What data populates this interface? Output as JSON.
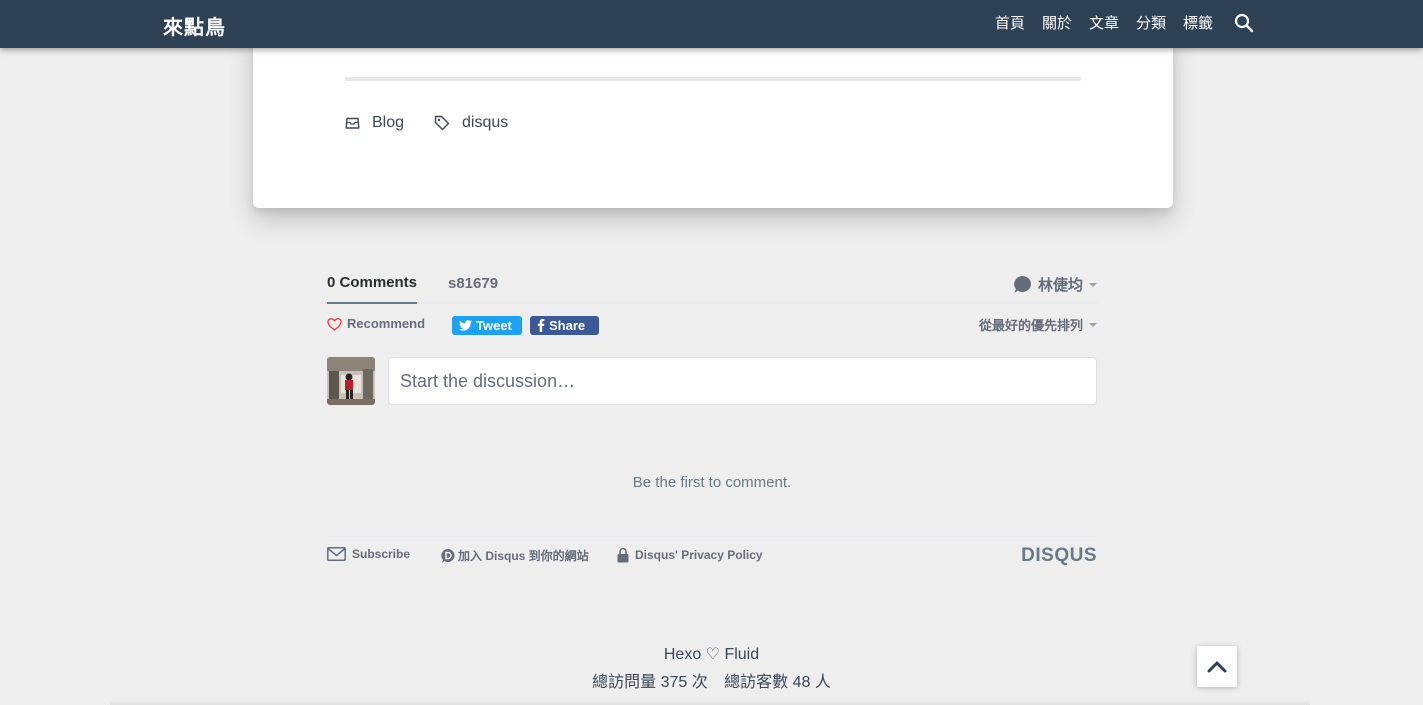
{
  "navbar": {
    "brand": "來點鳥",
    "items": [
      {
        "label": "首頁"
      },
      {
        "label": "關於"
      },
      {
        "label": "文章"
      },
      {
        "label": "分類"
      },
      {
        "label": "標籤"
      }
    ],
    "search_icon": "search-icon",
    "color": "#2f4154"
  },
  "post_meta": {
    "category": "Blog",
    "tag": "disqus"
  },
  "disqus": {
    "tabs": {
      "comments": "0 Comments",
      "site": "s81679"
    },
    "user": "林倢均",
    "recommend": "Recommend",
    "tweet": "Tweet",
    "share": "Share",
    "sort": "從最好的優先排列",
    "reply_placeholder": "Start the discussion…",
    "empty_message": "Be the first to comment.",
    "footer": {
      "subscribe": "Subscribe",
      "add_disqus": "加入 Disqus 到你的網站",
      "privacy": "Disqus' Privacy Policy",
      "logo": "DISQUS"
    },
    "colors": {
      "tweet": "#1da1f2",
      "share": "#3b5998",
      "heart": "#e24747"
    }
  },
  "site_footer": {
    "line1": "Hexo ♡ Fluid",
    "visits": "總訪問量 375 次",
    "visitors": "總訪客數 48 人"
  }
}
